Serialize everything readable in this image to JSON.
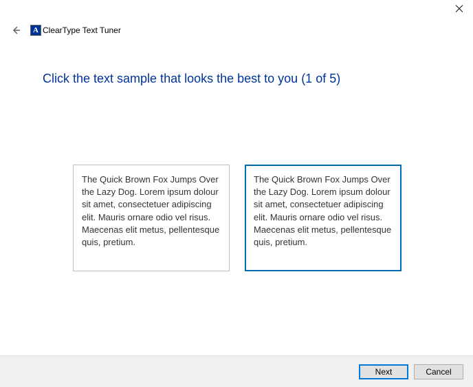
{
  "window": {
    "title": "ClearType Text Tuner",
    "app_icon_letter": "A"
  },
  "heading": "Click the text sample that looks the best to you (1 of 5)",
  "samples": [
    {
      "text": "The Quick Brown Fox Jumps Over the Lazy Dog. Lorem ipsum dolour sit amet, consectetuer adipiscing elit. Mauris ornare odio vel risus. Maecenas elit metus, pellentesque quis, pretium.",
      "selected": false
    },
    {
      "text": "The Quick Brown Fox Jumps Over the Lazy Dog. Lorem ipsum dolour sit amet, consectetuer adipiscing elit. Mauris ornare odio vel risus. Maecenas elit metus, pellentesque quis, pretium.",
      "selected": true
    }
  ],
  "footer": {
    "next": "Next",
    "cancel": "Cancel"
  }
}
